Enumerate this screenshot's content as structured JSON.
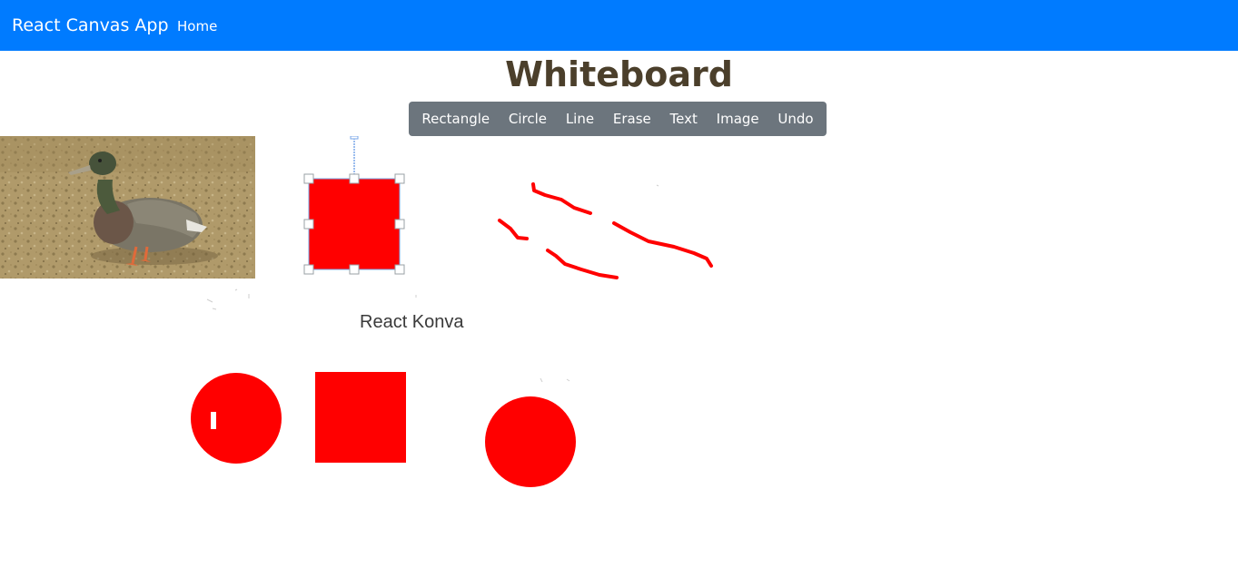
{
  "navbar": {
    "brand": "React Canvas App",
    "links": [
      {
        "label": "Home"
      }
    ],
    "background": "#007bff"
  },
  "page": {
    "title": "Whiteboard"
  },
  "toolbar": {
    "buttons": [
      {
        "label": "Rectangle"
      },
      {
        "label": "Circle"
      },
      {
        "label": "Line"
      },
      {
        "label": "Erase"
      },
      {
        "label": "Text"
      },
      {
        "label": "Image"
      },
      {
        "label": "Undo"
      }
    ],
    "background": "#6c757d"
  },
  "canvas": {
    "text_items": [
      {
        "text": "React Konva"
      }
    ],
    "shape_color": "#ff0000",
    "image": {
      "subject": "duck"
    }
  }
}
